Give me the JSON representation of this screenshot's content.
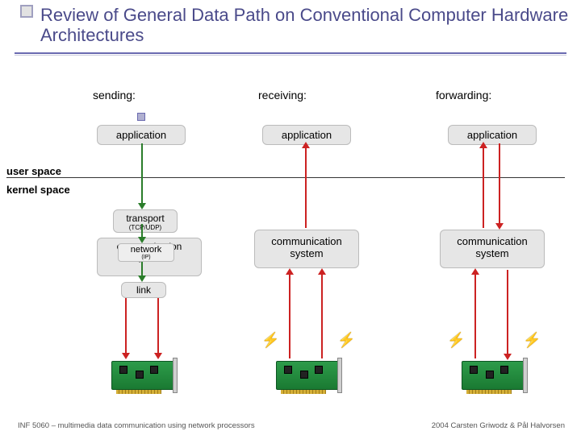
{
  "title": "Review of General Data Path on Conventional Computer Hardware Architectures",
  "columns": {
    "sending": "sending:",
    "receiving": "receiving:",
    "forwarding": "forwarding:"
  },
  "boxes": {
    "application": "application",
    "transport": "transport",
    "transport_sub": "(TCP/UDP)",
    "communication_system": "communication system",
    "network": "network",
    "network_sub": "(IP)",
    "link": "link"
  },
  "spaces": {
    "user": "user space",
    "kernel": "kernel space"
  },
  "footer": {
    "left": "INF 5060 – multimedia data communication using network processors",
    "right": "2004  Carsten Griwodz & Pål Halvorsen"
  }
}
